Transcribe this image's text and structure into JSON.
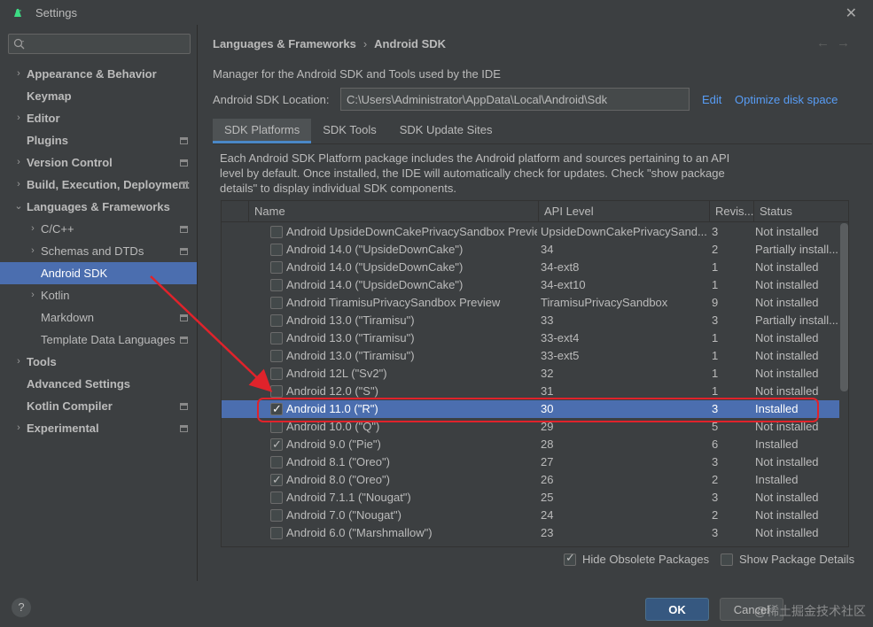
{
  "window": {
    "title": "Settings",
    "close_glyph": "✕"
  },
  "search": {
    "placeholder": "",
    "icon": "search-icon"
  },
  "sidebar": {
    "items": [
      {
        "label": "Appearance & Behavior",
        "chevron": "›",
        "bold": true
      },
      {
        "label": "Keymap",
        "chevron": "",
        "bold": true
      },
      {
        "label": "Editor",
        "chevron": "›",
        "bold": true
      },
      {
        "label": "Plugins",
        "chevron": "",
        "bold": true
      },
      {
        "label": "Version Control",
        "chevron": "›",
        "bold": true
      },
      {
        "label": "Build, Execution, Deployment",
        "chevron": "›",
        "bold": true
      },
      {
        "label": "Languages & Frameworks",
        "chevron": "⌄",
        "bold": true
      },
      {
        "label": "C/C++",
        "chevron": "›",
        "bold": false
      },
      {
        "label": "Schemas and DTDs",
        "chevron": "›",
        "bold": false
      },
      {
        "label": "Android SDK",
        "chevron": "",
        "bold": false,
        "selected": true
      },
      {
        "label": "Kotlin",
        "chevron": "›",
        "bold": false
      },
      {
        "label": "Markdown",
        "chevron": "",
        "bold": false
      },
      {
        "label": "Template Data Languages",
        "chevron": "",
        "bold": false
      },
      {
        "label": "Tools",
        "chevron": "›",
        "bold": true
      },
      {
        "label": "Advanced Settings",
        "chevron": "",
        "bold": true
      },
      {
        "label": "Kotlin Compiler",
        "chevron": "",
        "bold": true
      },
      {
        "label": "Experimental",
        "chevron": "›",
        "bold": true
      }
    ]
  },
  "breadcrumb": {
    "parent": "Languages & Frameworks",
    "separator": "›",
    "current": "Android SDK",
    "back": "←",
    "forward": "→"
  },
  "manager_desc": "Manager for the Android SDK and Tools used by the IDE",
  "sdk_location": {
    "label": "Android SDK Location:",
    "value": "C:\\Users\\Administrator\\AppData\\Local\\Android\\Sdk",
    "edit": "Edit",
    "optimize": "Optimize disk space"
  },
  "tabs": [
    "SDK Platforms",
    "SDK Tools",
    "SDK Update Sites"
  ],
  "platforms_desc": "Each Android SDK Platform package includes the Android platform and sources pertaining to an API level by default. Once installed, the IDE will automatically check for updates. Check \"show package details\" to display individual SDK components.",
  "table": {
    "headers": [
      "Name",
      "API Level",
      "Revis...",
      "Status"
    ],
    "rows": [
      {
        "checked": false,
        "name": "Android UpsideDownCakePrivacySandbox Previe",
        "api": "UpsideDownCakePrivacySand...",
        "rev": "3",
        "status": "Not installed"
      },
      {
        "checked": false,
        "name": "Android 14.0 (\"UpsideDownCake\")",
        "api": "34",
        "rev": "2",
        "status": "Partially install..."
      },
      {
        "checked": false,
        "name": "Android 14.0 (\"UpsideDownCake\")",
        "api": "34-ext8",
        "rev": "1",
        "status": "Not installed"
      },
      {
        "checked": false,
        "name": "Android 14.0 (\"UpsideDownCake\")",
        "api": "34-ext10",
        "rev": "1",
        "status": "Not installed"
      },
      {
        "checked": false,
        "name": "Android TiramisuPrivacySandbox Preview",
        "api": "TiramisuPrivacySandbox",
        "rev": "9",
        "status": "Not installed"
      },
      {
        "checked": false,
        "name": "Android 13.0 (\"Tiramisu\")",
        "api": "33",
        "rev": "3",
        "status": "Partially install..."
      },
      {
        "checked": false,
        "name": "Android 13.0 (\"Tiramisu\")",
        "api": "33-ext4",
        "rev": "1",
        "status": "Not installed"
      },
      {
        "checked": false,
        "name": "Android 13.0 (\"Tiramisu\")",
        "api": "33-ext5",
        "rev": "1",
        "status": "Not installed"
      },
      {
        "checked": false,
        "name": "Android 12L (\"Sv2\")",
        "api": "32",
        "rev": "1",
        "status": "Not installed"
      },
      {
        "checked": false,
        "name": "Android 12.0 (\"S\")",
        "api": "31",
        "rev": "1",
        "status": "Not installed"
      },
      {
        "checked": true,
        "name": "Android 11.0 (\"R\")",
        "api": "30",
        "rev": "3",
        "status": "Installed",
        "selected": true
      },
      {
        "checked": false,
        "name": "Android 10.0 (\"Q\")",
        "api": "29",
        "rev": "5",
        "status": "Not installed"
      },
      {
        "checked": true,
        "name": "Android 9.0 (\"Pie\")",
        "api": "28",
        "rev": "6",
        "status": "Installed"
      },
      {
        "checked": false,
        "name": "Android 8.1 (\"Oreo\")",
        "api": "27",
        "rev": "3",
        "status": "Not installed"
      },
      {
        "checked": true,
        "name": "Android 8.0 (\"Oreo\")",
        "api": "26",
        "rev": "2",
        "status": "Installed"
      },
      {
        "checked": false,
        "name": "Android 7.1.1 (\"Nougat\")",
        "api": "25",
        "rev": "3",
        "status": "Not installed"
      },
      {
        "checked": false,
        "name": "Android 7.0 (\"Nougat\")",
        "api": "24",
        "rev": "2",
        "status": "Not installed"
      },
      {
        "checked": false,
        "name": "Android 6.0 (\"Marshmallow\")",
        "api": "23",
        "rev": "3",
        "status": "Not installed"
      }
    ]
  },
  "options": {
    "hide_obsolete": {
      "label": "Hide Obsolete Packages",
      "checked": true
    },
    "show_details": {
      "label": "Show Package Details",
      "checked": false
    }
  },
  "footer": {
    "help": "?",
    "ok": "OK",
    "cancel": "Cancel",
    "watermark": "@稀土掘金技术社区"
  },
  "colors": {
    "selection": "#4b6eaf",
    "annotation": "#e0232b",
    "link": "#589df6"
  }
}
